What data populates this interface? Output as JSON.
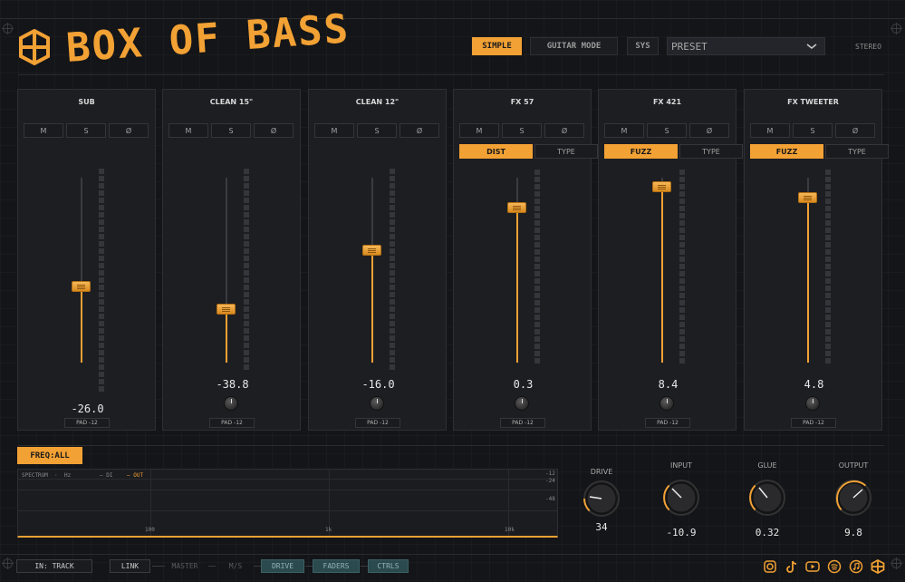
{
  "header": {
    "title": "BOX OF BASS",
    "modes": [
      "SIMPLE",
      "GUITAR MODE"
    ],
    "active_mode": "SIMPLE",
    "sys_label": "SYS",
    "preset_value": "PRESET",
    "output_mode": "STEREO"
  },
  "channels": [
    {
      "name": "SUB",
      "m": "M",
      "s": "S",
      "phase": "Ø",
      "fx": null,
      "value": "-26.0",
      "level": 0.41,
      "pad": "PAD -12"
    },
    {
      "name": "CLEAN 15\"",
      "m": "M",
      "s": "S",
      "phase": "Ø",
      "fx": null,
      "value": "-38.8",
      "level": 0.29,
      "pad": "PAD -12"
    },
    {
      "name": "CLEAN 12\"",
      "m": "M",
      "s": "S",
      "phase": "Ø",
      "fx": null,
      "value": "-16.0",
      "level": 0.61,
      "pad": "PAD -12"
    },
    {
      "name": "FX 57",
      "m": "M",
      "s": "S",
      "phase": "Ø",
      "fx": "DIST",
      "type": "TYPE",
      "value": "0.3",
      "level": 0.84,
      "pad": "PAD -12"
    },
    {
      "name": "FX 421",
      "m": "M",
      "s": "S",
      "phase": "Ø",
      "fx": "FUZZ",
      "type": "TYPE",
      "value": "8.4",
      "level": 0.95,
      "pad": "PAD -12"
    },
    {
      "name": "FX TWEETER",
      "m": "M",
      "s": "S",
      "phase": "Ø",
      "fx": "FUZZ",
      "type": "TYPE",
      "value": "4.8",
      "level": 0.89,
      "pad": "PAD -12"
    }
  ],
  "freq_button": "FREQ:ALL",
  "spectrum": {
    "label": "SPECTRUM",
    "dot": "·",
    "unit": "Hz",
    "legend_di": "— DI",
    "legend_out": "— OUT",
    "db_labels": [
      "-12",
      "-24",
      "-48"
    ],
    "freq_labels": [
      "100",
      "1k",
      "10k"
    ]
  },
  "knobs": [
    {
      "label": "DRIVE",
      "value": "34"
    },
    {
      "label": "INPUT",
      "value": "-10.9"
    },
    {
      "label": "GLUE",
      "value": "0.32"
    },
    {
      "label": "OUTPUT",
      "value": "9.8"
    }
  ],
  "footer": {
    "in_track": "IN: TRACK",
    "link": "LINK",
    "master": "MASTER",
    "ms": "M/S",
    "drive": "DRIVE",
    "faders": "FADERS",
    "ctrls": "CTRLS"
  },
  "social_icons": [
    "instagram-icon",
    "tiktok-icon",
    "youtube-icon",
    "spotify-icon",
    "apple-music-icon",
    "brand-logo-icon"
  ],
  "colors": {
    "accent": "#f2a134",
    "background": "#141518",
    "panel": "#1d1e22",
    "teal": "#2b4a4e"
  }
}
